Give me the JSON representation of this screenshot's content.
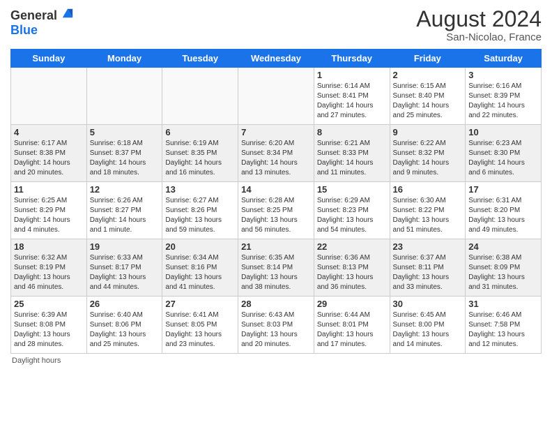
{
  "header": {
    "logo_line1": "General",
    "logo_line2": "Blue",
    "month_year": "August 2024",
    "location": "San-Nicolao, France"
  },
  "days_of_week": [
    "Sunday",
    "Monday",
    "Tuesday",
    "Wednesday",
    "Thursday",
    "Friday",
    "Saturday"
  ],
  "weeks": [
    [
      {
        "date": "",
        "info": "",
        "shaded": true
      },
      {
        "date": "",
        "info": "",
        "shaded": true
      },
      {
        "date": "",
        "info": "",
        "shaded": true
      },
      {
        "date": "",
        "info": "",
        "shaded": true
      },
      {
        "date": "1",
        "info": "Sunrise: 6:14 AM\nSunset: 8:41 PM\nDaylight: 14 hours and 27 minutes.",
        "shaded": false
      },
      {
        "date": "2",
        "info": "Sunrise: 6:15 AM\nSunset: 8:40 PM\nDaylight: 14 hours and 25 minutes.",
        "shaded": false
      },
      {
        "date": "3",
        "info": "Sunrise: 6:16 AM\nSunset: 8:39 PM\nDaylight: 14 hours and 22 minutes.",
        "shaded": false
      }
    ],
    [
      {
        "date": "4",
        "info": "Sunrise: 6:17 AM\nSunset: 8:38 PM\nDaylight: 14 hours and 20 minutes.",
        "shaded": true
      },
      {
        "date": "5",
        "info": "Sunrise: 6:18 AM\nSunset: 8:37 PM\nDaylight: 14 hours and 18 minutes.",
        "shaded": true
      },
      {
        "date": "6",
        "info": "Sunrise: 6:19 AM\nSunset: 8:35 PM\nDaylight: 14 hours and 16 minutes.",
        "shaded": true
      },
      {
        "date": "7",
        "info": "Sunrise: 6:20 AM\nSunset: 8:34 PM\nDaylight: 14 hours and 13 minutes.",
        "shaded": true
      },
      {
        "date": "8",
        "info": "Sunrise: 6:21 AM\nSunset: 8:33 PM\nDaylight: 14 hours and 11 minutes.",
        "shaded": true
      },
      {
        "date": "9",
        "info": "Sunrise: 6:22 AM\nSunset: 8:32 PM\nDaylight: 14 hours and 9 minutes.",
        "shaded": true
      },
      {
        "date": "10",
        "info": "Sunrise: 6:23 AM\nSunset: 8:30 PM\nDaylight: 14 hours and 6 minutes.",
        "shaded": true
      }
    ],
    [
      {
        "date": "11",
        "info": "Sunrise: 6:25 AM\nSunset: 8:29 PM\nDaylight: 14 hours and 4 minutes.",
        "shaded": false
      },
      {
        "date": "12",
        "info": "Sunrise: 6:26 AM\nSunset: 8:27 PM\nDaylight: 14 hours and 1 minute.",
        "shaded": false
      },
      {
        "date": "13",
        "info": "Sunrise: 6:27 AM\nSunset: 8:26 PM\nDaylight: 13 hours and 59 minutes.",
        "shaded": false
      },
      {
        "date": "14",
        "info": "Sunrise: 6:28 AM\nSunset: 8:25 PM\nDaylight: 13 hours and 56 minutes.",
        "shaded": false
      },
      {
        "date": "15",
        "info": "Sunrise: 6:29 AM\nSunset: 8:23 PM\nDaylight: 13 hours and 54 minutes.",
        "shaded": false
      },
      {
        "date": "16",
        "info": "Sunrise: 6:30 AM\nSunset: 8:22 PM\nDaylight: 13 hours and 51 minutes.",
        "shaded": false
      },
      {
        "date": "17",
        "info": "Sunrise: 6:31 AM\nSunset: 8:20 PM\nDaylight: 13 hours and 49 minutes.",
        "shaded": false
      }
    ],
    [
      {
        "date": "18",
        "info": "Sunrise: 6:32 AM\nSunset: 8:19 PM\nDaylight: 13 hours and 46 minutes.",
        "shaded": true
      },
      {
        "date": "19",
        "info": "Sunrise: 6:33 AM\nSunset: 8:17 PM\nDaylight: 13 hours and 44 minutes.",
        "shaded": true
      },
      {
        "date": "20",
        "info": "Sunrise: 6:34 AM\nSunset: 8:16 PM\nDaylight: 13 hours and 41 minutes.",
        "shaded": true
      },
      {
        "date": "21",
        "info": "Sunrise: 6:35 AM\nSunset: 8:14 PM\nDaylight: 13 hours and 38 minutes.",
        "shaded": true
      },
      {
        "date": "22",
        "info": "Sunrise: 6:36 AM\nSunset: 8:13 PM\nDaylight: 13 hours and 36 minutes.",
        "shaded": true
      },
      {
        "date": "23",
        "info": "Sunrise: 6:37 AM\nSunset: 8:11 PM\nDaylight: 13 hours and 33 minutes.",
        "shaded": true
      },
      {
        "date": "24",
        "info": "Sunrise: 6:38 AM\nSunset: 8:09 PM\nDaylight: 13 hours and 31 minutes.",
        "shaded": true
      }
    ],
    [
      {
        "date": "25",
        "info": "Sunrise: 6:39 AM\nSunset: 8:08 PM\nDaylight: 13 hours and 28 minutes.",
        "shaded": false
      },
      {
        "date": "26",
        "info": "Sunrise: 6:40 AM\nSunset: 8:06 PM\nDaylight: 13 hours and 25 minutes.",
        "shaded": false
      },
      {
        "date": "27",
        "info": "Sunrise: 6:41 AM\nSunset: 8:05 PM\nDaylight: 13 hours and 23 minutes.",
        "shaded": false
      },
      {
        "date": "28",
        "info": "Sunrise: 6:43 AM\nSunset: 8:03 PM\nDaylight: 13 hours and 20 minutes.",
        "shaded": false
      },
      {
        "date": "29",
        "info": "Sunrise: 6:44 AM\nSunset: 8:01 PM\nDaylight: 13 hours and 17 minutes.",
        "shaded": false
      },
      {
        "date": "30",
        "info": "Sunrise: 6:45 AM\nSunset: 8:00 PM\nDaylight: 13 hours and 14 minutes.",
        "shaded": false
      },
      {
        "date": "31",
        "info": "Sunrise: 6:46 AM\nSunset: 7:58 PM\nDaylight: 13 hours and 12 minutes.",
        "shaded": false
      }
    ]
  ],
  "footer": {
    "daylight_label": "Daylight hours"
  }
}
